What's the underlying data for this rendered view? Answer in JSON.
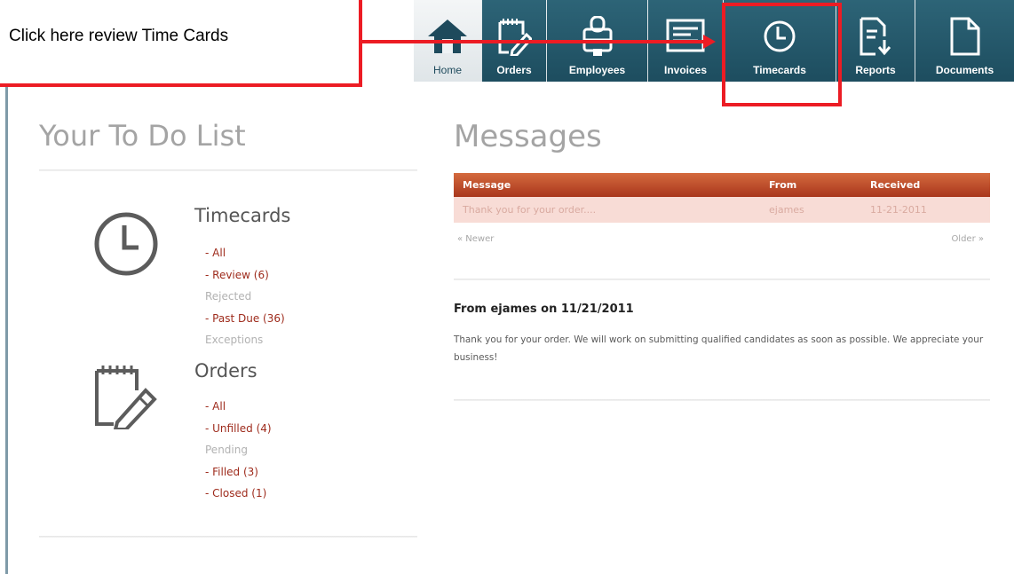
{
  "callout": {
    "text": "Click here review Time Cards",
    "accent_color": "#ec1c24"
  },
  "nav": {
    "items": [
      {
        "label": "Home",
        "icon": "home-icon",
        "selected": true
      },
      {
        "label": "Orders",
        "icon": "notepad-pencil-icon"
      },
      {
        "label": "Employees",
        "icon": "person-badge-icon"
      },
      {
        "label": "Invoices",
        "icon": "invoice-icon"
      },
      {
        "label": "Timecards",
        "icon": "clock-icon"
      },
      {
        "label": "Reports",
        "icon": "report-download-icon"
      },
      {
        "label": "Documents",
        "icon": "document-icon"
      }
    ],
    "bar_color": "#245a6c"
  },
  "todo": {
    "title": "Your To Do List",
    "timecards": {
      "heading": "Timecards",
      "icon": "clock-icon",
      "items": [
        "- All",
        "- Review (6)",
        "Rejected",
        "- Past Due (36)",
        "Exceptions"
      ]
    },
    "orders": {
      "heading": "Orders",
      "icon": "notepad-pencil-icon",
      "items": [
        "- All",
        "- Unfilled (4)",
        "Pending",
        "- Filled (3)",
        "- Closed (1)"
      ]
    },
    "link_color": "#9e2b1c"
  },
  "messages": {
    "title": "Messages",
    "columns": [
      "Message",
      "From",
      "Received"
    ],
    "rows": [
      [
        "Thank you for your order....",
        "ejames",
        "11-21-2011"
      ]
    ],
    "pager": {
      "newer": "« Newer",
      "older": "Older »"
    },
    "detail": {
      "heading": "From ejames on 11/21/2011",
      "body": "Thank you for your order. We will work on submitting qualified candidates as soon as possible. We appreciate your business!"
    },
    "header_color": "#c0502c"
  }
}
